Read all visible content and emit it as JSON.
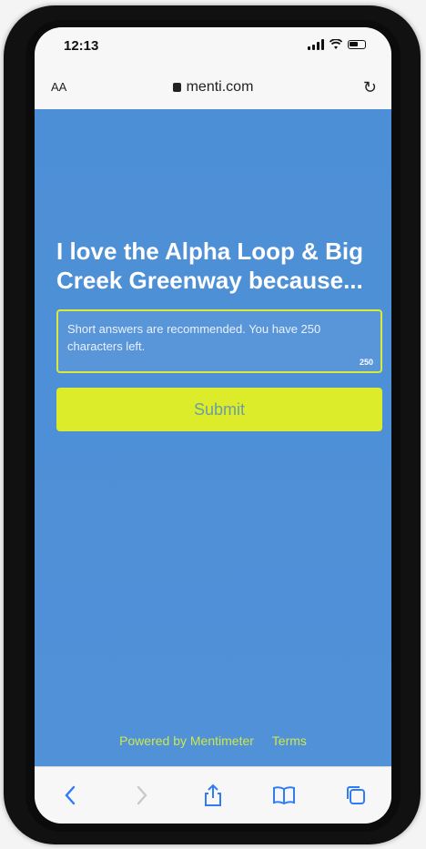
{
  "status": {
    "time": "12:13"
  },
  "browser": {
    "text_size_label": "AA",
    "url": "menti.com",
    "reload_icon": "reload-icon"
  },
  "question": {
    "title": "I love the Alpha Loop & Big Creek Greenway because..."
  },
  "answer": {
    "placeholder": "Short answers are recommended. You have 250 characters left.",
    "counter": "250"
  },
  "submit": {
    "label": "Submit"
  },
  "footer": {
    "powered_by": "Powered by Mentimeter",
    "terms": "Terms"
  },
  "toolbar": {
    "icons": [
      "back-icon",
      "forward-icon",
      "share-icon",
      "bookmarks-icon",
      "tabs-icon"
    ]
  },
  "colors": {
    "background": "#4d8fd6",
    "accent": "#dcec2a",
    "footer_text": "#cce84a"
  }
}
